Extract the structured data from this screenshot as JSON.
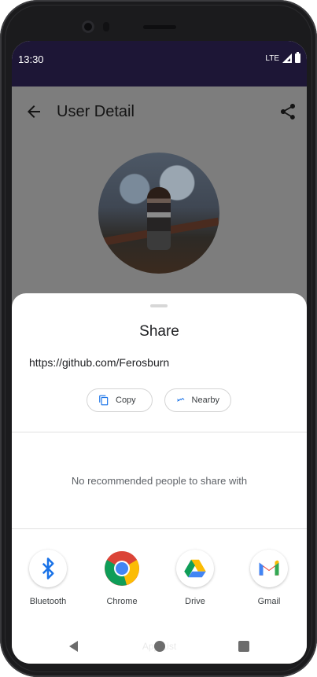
{
  "status_bar": {
    "time": "13:30",
    "network": "LTE"
  },
  "app": {
    "title": "User Detail"
  },
  "share_sheet": {
    "title": "Share",
    "url": "https://github.com/Ferosburn",
    "chips": {
      "copy": "Copy",
      "nearby": "Nearby"
    },
    "no_recommendations": "No recommended people to share with",
    "targets": [
      {
        "label": "Bluetooth",
        "icon": "bluetooth-icon"
      },
      {
        "label": "Chrome",
        "icon": "chrome-icon"
      },
      {
        "label": "Drive",
        "icon": "drive-icon"
      },
      {
        "label": "Gmail",
        "icon": "gmail-icon"
      }
    ],
    "background_hint": "App List"
  },
  "colors": {
    "status_bar": "#1d1636",
    "scrim": "#7d7d7d",
    "accent_blue": "#1a73e8"
  }
}
